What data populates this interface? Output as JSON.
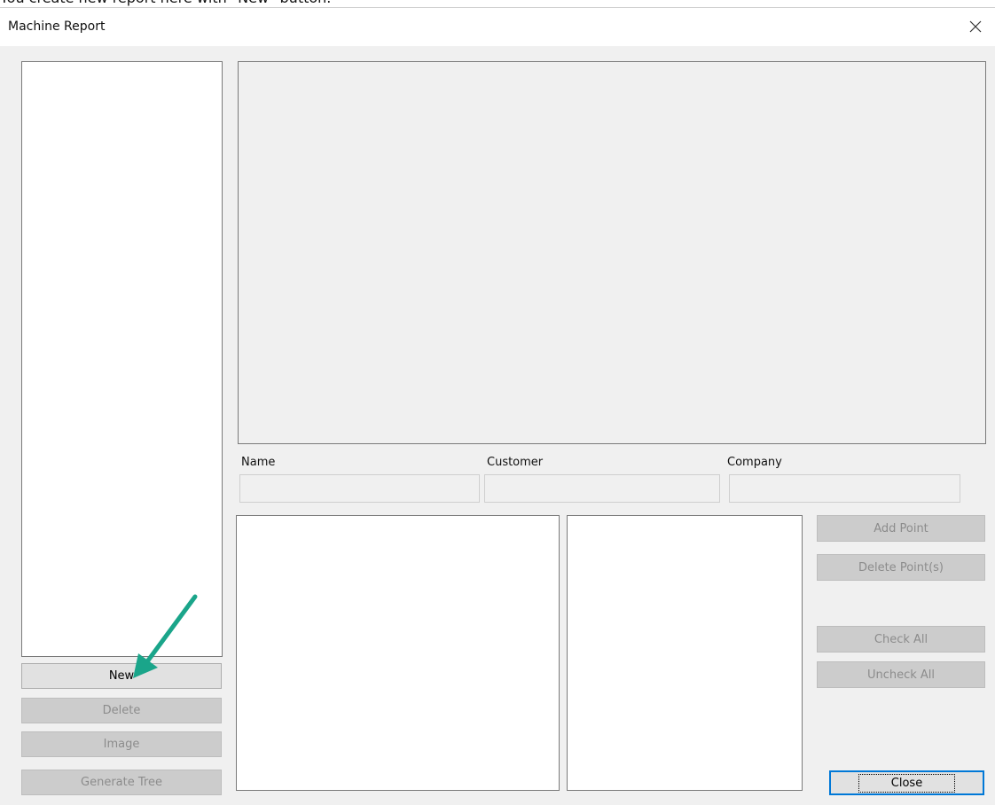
{
  "caption": "You create new report here with \"New\" button.",
  "window": {
    "title": "Machine Report",
    "close_icon": "close-icon"
  },
  "fields": {
    "name_label": "Name",
    "customer_label": "Customer",
    "company_label": "Company",
    "name_value": "",
    "customer_value": "",
    "company_value": ""
  },
  "left_buttons": {
    "new": "New",
    "delete": "Delete",
    "image": "Image",
    "generate_tree": "Generate Tree"
  },
  "right_buttons": {
    "add_point": "Add Point",
    "delete_points": "Delete Point(s)",
    "check_all": "Check All",
    "uncheck_all": "Uncheck All",
    "close": "Close"
  },
  "colors": {
    "annotation_arrow": "#1aa58a",
    "focus_border": "#0078d7"
  }
}
